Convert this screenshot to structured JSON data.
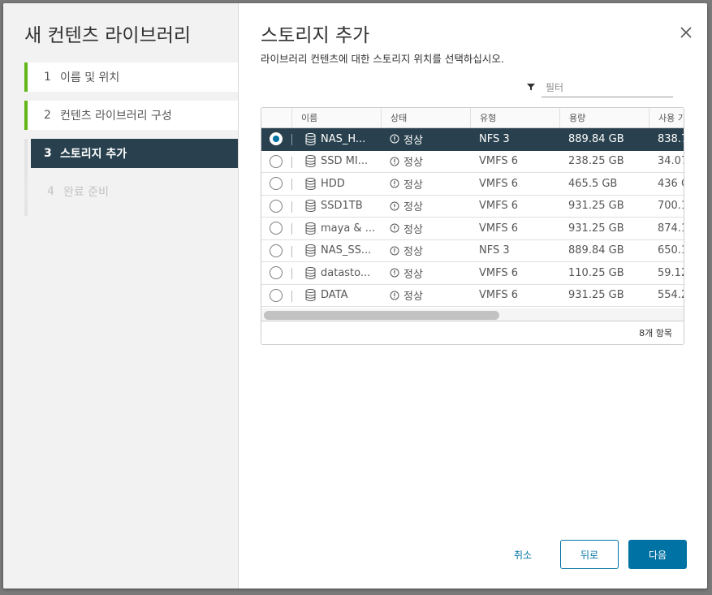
{
  "wizard": {
    "title": "새 컨텐츠 라이브러리",
    "steps": [
      {
        "num": "1",
        "label": "이름 및 위치"
      },
      {
        "num": "2",
        "label": "컨텐츠 라이브러리 구성"
      },
      {
        "num": "3",
        "label": "스토리지 추가"
      },
      {
        "num": "4",
        "label": "완료 준비"
      }
    ]
  },
  "page": {
    "title": "스토리지 추가",
    "subtitle": "라이브러리 컨텐츠에 대한 스토리지 위치를 선택하십시오."
  },
  "filter": {
    "placeholder": "필터"
  },
  "grid": {
    "columns": [
      "이름",
      "상태",
      "유형",
      "용량",
      "사용 가"
    ],
    "rows": [
      {
        "name": "NAS_H...",
        "state": "정상",
        "type": "NFS 3",
        "capacity": "889.84 GB",
        "used": "838.7",
        "selected": true
      },
      {
        "name": "SSD MI...",
        "state": "정상",
        "type": "VMFS 6",
        "capacity": "238.25 GB",
        "used": "34.07",
        "selected": false
      },
      {
        "name": "HDD",
        "state": "정상",
        "type": "VMFS 6",
        "capacity": "465.5 GB",
        "used": "436 G",
        "selected": false
      },
      {
        "name": "SSD1TB",
        "state": "정상",
        "type": "VMFS 6",
        "capacity": "931.25 GB",
        "used": "700.1",
        "selected": false
      },
      {
        "name": "maya & ...",
        "state": "정상",
        "type": "VMFS 6",
        "capacity": "931.25 GB",
        "used": "874.1",
        "selected": false
      },
      {
        "name": "NAS_SS...",
        "state": "정상",
        "type": "NFS 3",
        "capacity": "889.84 GB",
        "used": "650.1",
        "selected": false
      },
      {
        "name": "datasto...",
        "state": "정상",
        "type": "VMFS 6",
        "capacity": "110.25 GB",
        "used": "59.12",
        "selected": false
      },
      {
        "name": "DATA",
        "state": "정상",
        "type": "VMFS 6",
        "capacity": "931.25 GB",
        "used": "554.2",
        "selected": false
      }
    ],
    "footer": "8개 항목"
  },
  "buttons": {
    "cancel": "취소",
    "back": "뒤로",
    "next": "다음"
  },
  "colors": {
    "accent": "#0072a3",
    "selected_row": "#29414e",
    "step_done": "#61b715"
  }
}
